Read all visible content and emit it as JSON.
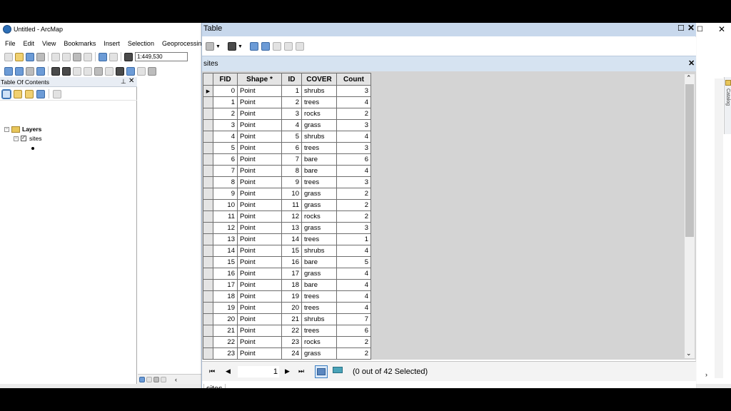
{
  "app": {
    "title": "Untitled - ArcMap",
    "maximize_glyph": "☐",
    "close_glyph": "✕"
  },
  "menu": [
    "File",
    "Edit",
    "View",
    "Bookmarks",
    "Insert",
    "Selection",
    "Geoprocessing"
  ],
  "toolbar": {
    "scale_value": "1:449,530"
  },
  "toc": {
    "title": "Table Of Contents",
    "pin_glyph": "⊥",
    "close_glyph": "✕",
    "tree": {
      "group_label": "Layers",
      "layer_label": "sites",
      "expander": "−",
      "check": "✓"
    }
  },
  "catalog_label": "Catalog",
  "table_window": {
    "title": "Table",
    "maximize_glyph": "☐",
    "close_glyph": "✕",
    "tab_title": "sites",
    "tab_close_glyph": "✕",
    "columns": [
      "FID",
      "Shape *",
      "ID",
      "COVER",
      "Count"
    ],
    "current_row_marker": "▶",
    "rows": [
      [
        "0",
        "Point",
        "1",
        "shrubs",
        "3"
      ],
      [
        "1",
        "Point",
        "2",
        "trees",
        "4"
      ],
      [
        "2",
        "Point",
        "3",
        "rocks",
        "2"
      ],
      [
        "3",
        "Point",
        "4",
        "grass",
        "3"
      ],
      [
        "4",
        "Point",
        "5",
        "shrubs",
        "4"
      ],
      [
        "5",
        "Point",
        "6",
        "trees",
        "3"
      ],
      [
        "6",
        "Point",
        "7",
        "bare",
        "6"
      ],
      [
        "7",
        "Point",
        "8",
        "bare",
        "4"
      ],
      [
        "8",
        "Point",
        "9",
        "trees",
        "3"
      ],
      [
        "9",
        "Point",
        "10",
        "grass",
        "2"
      ],
      [
        "10",
        "Point",
        "11",
        "grass",
        "2"
      ],
      [
        "11",
        "Point",
        "12",
        "rocks",
        "2"
      ],
      [
        "12",
        "Point",
        "13",
        "grass",
        "3"
      ],
      [
        "13",
        "Point",
        "14",
        "trees",
        "1"
      ],
      [
        "14",
        "Point",
        "15",
        "shrubs",
        "4"
      ],
      [
        "15",
        "Point",
        "16",
        "bare",
        "5"
      ],
      [
        "16",
        "Point",
        "17",
        "grass",
        "4"
      ],
      [
        "17",
        "Point",
        "18",
        "bare",
        "4"
      ],
      [
        "18",
        "Point",
        "19",
        "trees",
        "4"
      ],
      [
        "19",
        "Point",
        "20",
        "trees",
        "4"
      ],
      [
        "20",
        "Point",
        "21",
        "shrubs",
        "7"
      ],
      [
        "21",
        "Point",
        "22",
        "trees",
        "6"
      ],
      [
        "22",
        "Point",
        "23",
        "rocks",
        "2"
      ],
      [
        "23",
        "Point",
        "24",
        "grass",
        "2"
      ]
    ],
    "nav": {
      "first_glyph": "⏮",
      "prev_glyph": "◀",
      "next_glyph": "▶",
      "last_glyph": "⏭",
      "current_record": "1",
      "selection_status": "(0 out of 42 Selected)"
    },
    "scroll": {
      "up_glyph": "⌃",
      "down_glyph": "⌄"
    },
    "bottom_tab": "sites"
  },
  "colors": {
    "table_titlebar": "#c8d8ec",
    "tabbar": "#d6e3f1",
    "grid_background": "#d4d4d4",
    "header_fill": "#e4e4e4"
  }
}
